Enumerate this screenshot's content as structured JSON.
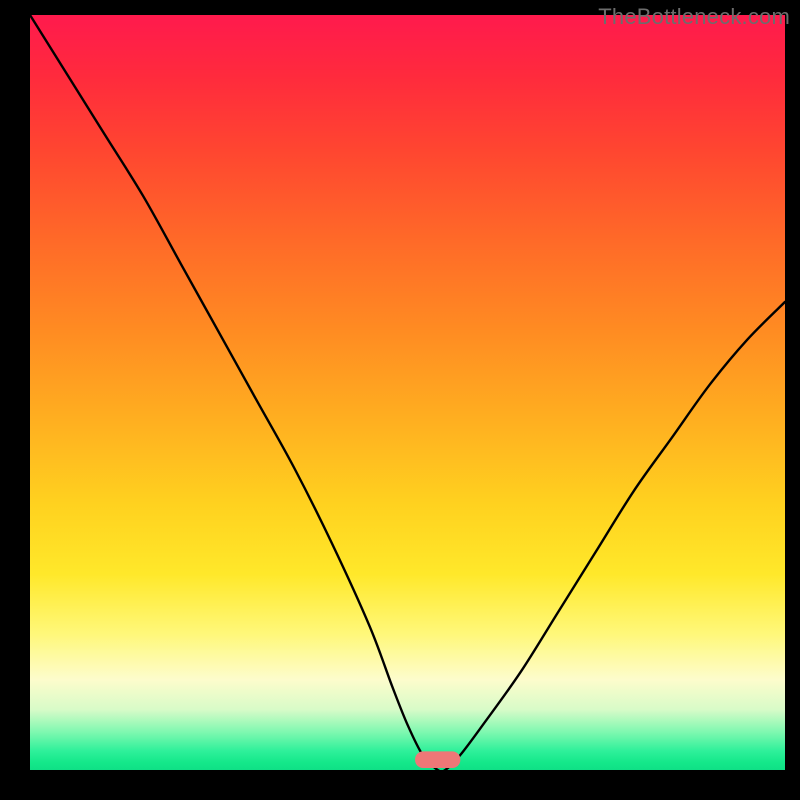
{
  "watermark": "TheBottleneck.com",
  "chart_data": {
    "type": "line",
    "title": "",
    "xlabel": "",
    "ylabel": "",
    "xlim": [
      0,
      100
    ],
    "ylim": [
      0,
      100
    ],
    "grid": false,
    "legend": false,
    "series": [
      {
        "name": "curve",
        "x": [
          0,
          5,
          10,
          15,
          20,
          25,
          30,
          35,
          40,
          45,
          48,
          50,
          52,
          54,
          55,
          57,
          60,
          65,
          70,
          75,
          80,
          85,
          90,
          95,
          100
        ],
        "y": [
          100,
          92,
          84,
          76,
          67,
          58,
          49,
          40,
          30,
          19,
          11,
          6,
          2,
          0,
          0,
          2,
          6,
          13,
          21,
          29,
          37,
          44,
          51,
          57,
          62
        ]
      }
    ],
    "marker": {
      "x": 54,
      "width": 6,
      "height": 2.2,
      "color": "#ef7777"
    },
    "colors": {
      "curve": "#000000",
      "frame_bg": "#000000",
      "gradient_top": "#ff1a4d",
      "gradient_bottom": "#0fe086",
      "watermark": "#6d6d6d"
    }
  }
}
